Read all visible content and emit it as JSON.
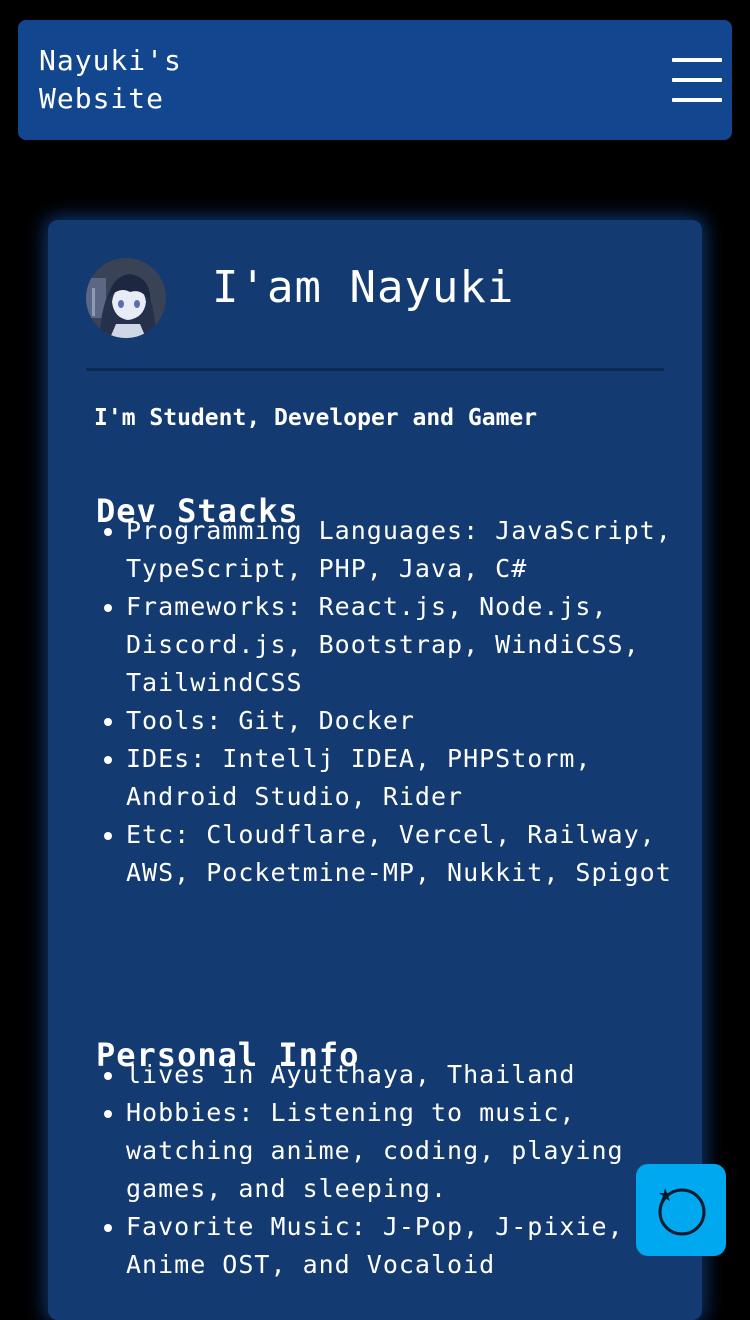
{
  "header": {
    "brand": "Nayuki's\nWebsite",
    "menu_icon": "hamburger-menu-icon",
    "background": "#12468e"
  },
  "profile": {
    "avatar_icon": "anime-avatar",
    "title": "I'am Nayuki",
    "tagline": "I'm Student, Developer and Gamer"
  },
  "dev_stacks": {
    "title": "Dev Stacks",
    "items": [
      "Programming Languages: JavaScript, TypeScript, PHP, Java, C#",
      "Frameworks: React.js, Node.js, Discord.js, Bootstrap, WindiCSS, TailwindCSS",
      "Tools: Git, Docker",
      "IDEs: Intellj IDEA, PHPStorm, Android Studio, Rider",
      "Etc: Cloudflare, Vercel, Railway, AWS, Pocketmine-MP, Nukkit, Spigot"
    ]
  },
  "personal_info": {
    "title": "Personal Info",
    "items": [
      "lives in Ayutthaya, Thailand",
      "Hobbies: Listening to music, watching anime, coding, playing games, and sleeping.",
      "Favorite Music: J-Pop, J-pixie, Anime OST, and Vocaloid"
    ]
  },
  "floating_button": {
    "icon": "theme-toggle-icon",
    "color": "#00a8f0"
  },
  "colors": {
    "page_background": "#000000",
    "card_background": "#133b72",
    "text": "#ffffff"
  }
}
